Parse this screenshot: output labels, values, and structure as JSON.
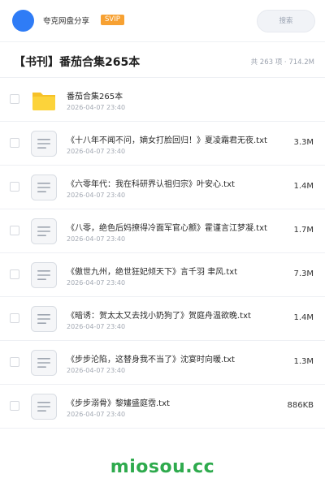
{
  "header": {
    "site_name": "夸克网盘分享",
    "badge": "SVIP",
    "search_placeholder": "搜索",
    "accent_color": "#2f7cf6",
    "badge_color": "#f7a132"
  },
  "folder": {
    "title": "【书刊】番茄合集265本",
    "stats": "共 263 项 · 714.2M"
  },
  "files": [
    {
      "type": "folder",
      "icon": "folder-icon",
      "name": "番茄合集265本",
      "date": "2026-04-07 23:40",
      "size": ""
    },
    {
      "type": "txt",
      "icon": "text-file-icon",
      "name": "《十八年不闻不问，嫡女打脸回归！》夏凌霜君无夜.txt",
      "date": "2026-04-07 23:40",
      "size": "3.3M"
    },
    {
      "type": "txt",
      "icon": "text-file-icon",
      "name": "《六零年代：我在科研界认祖归宗》叶安心.txt",
      "date": "2026-04-07 23:40",
      "size": "1.4M"
    },
    {
      "type": "txt",
      "icon": "text-file-icon",
      "name": "《八零，绝色后妈撩得冷面军官心颤》霍谨言江梦凝.txt",
      "date": "2026-04-07 23:40",
      "size": "1.7M"
    },
    {
      "type": "txt",
      "icon": "text-file-icon",
      "name": "《傲世九州，绝世狂妃倾天下》言千羽 聿风.txt",
      "date": "2026-04-07 23:40",
      "size": "7.3M"
    },
    {
      "type": "txt",
      "icon": "text-file-icon",
      "name": "《暗诱：贺太太又去找小奶狗了》贺庭舟温欲晚.txt",
      "date": "2026-04-07 23:40",
      "size": "1.4M"
    },
    {
      "type": "txt",
      "icon": "text-file-icon",
      "name": "《步步沦陷，这替身我不当了》沈宴时向暖.txt",
      "date": "2026-04-07 23:40",
      "size": "1.3M"
    },
    {
      "type": "txt",
      "icon": "text-file-icon",
      "name": "《步步溺骨》黎嫿盛庭霑.txt",
      "date": "2026-04-07 23:40",
      "size": "886KB"
    }
  ],
  "watermark": "miosou.cc"
}
